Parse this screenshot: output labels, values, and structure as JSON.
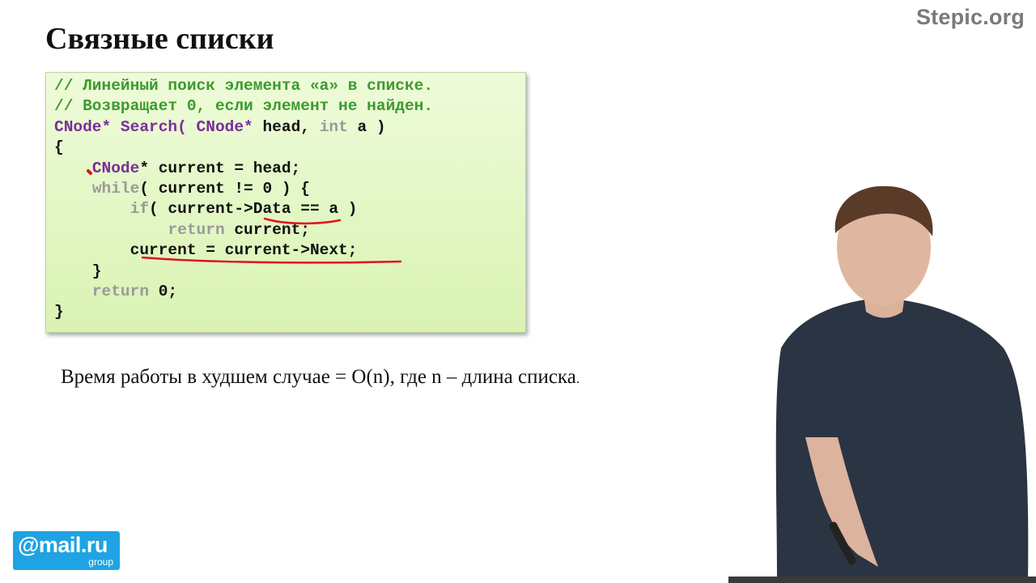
{
  "brand": {
    "site": "Stepic.org"
  },
  "slide": {
    "title": "Связные списки",
    "code": [
      [
        {
          "t": "// Линейный поиск элемента «a» в списке.",
          "c": "com"
        }
      ],
      [
        {
          "t": "// Возвращает 0, если элемент не найден.",
          "c": "com"
        }
      ],
      [
        {
          "t": "CNode*",
          "c": "type"
        },
        {
          "t": " ",
          "c": "txt"
        },
        {
          "t": "Search(",
          "c": "type"
        },
        {
          "t": " ",
          "c": "txt"
        },
        {
          "t": "CNode*",
          "c": "type"
        },
        {
          "t": " head, ",
          "c": "txt"
        },
        {
          "t": "int",
          "c": "kw"
        },
        {
          "t": " a )",
          "c": "txt"
        }
      ],
      [
        {
          "t": "{",
          "c": "txt"
        }
      ],
      [
        {
          "t": "    ",
          "c": "txt"
        },
        {
          "t": "CNode",
          "c": "type"
        },
        {
          "t": "* current = head;",
          "c": "txt"
        }
      ],
      [
        {
          "t": "    ",
          "c": "txt"
        },
        {
          "t": "while",
          "c": "kw"
        },
        {
          "t": "( current != 0 ) {",
          "c": "txt"
        }
      ],
      [
        {
          "t": "        ",
          "c": "txt"
        },
        {
          "t": "if",
          "c": "kw"
        },
        {
          "t": "( current->Data == a )",
          "c": "txt"
        }
      ],
      [
        {
          "t": "            ",
          "c": "txt"
        },
        {
          "t": "return",
          "c": "kw"
        },
        {
          "t": " current;",
          "c": "txt"
        }
      ],
      [
        {
          "t": "        current = current->Next;",
          "c": "txt"
        }
      ],
      [
        {
          "t": "    }",
          "c": "txt"
        }
      ],
      [
        {
          "t": "    ",
          "c": "txt"
        },
        {
          "t": "return",
          "c": "kw"
        },
        {
          "t": " 0;",
          "c": "txt"
        }
      ],
      [
        {
          "t": "}",
          "c": "txt"
        }
      ]
    ],
    "statement_main": "Время работы в худшем случае = O(n), где n – длина списка",
    "statement_end": "."
  },
  "logo": {
    "main": "@mail.ru",
    "sub": "group"
  },
  "colors": {
    "comment": "#3c9a2e",
    "type": "#7a2d9c",
    "keyword": "#9a9a9a",
    "annotation": "#e0101e",
    "brand_gray": "#7a7a7a",
    "logo_blue": "#1fa3e3"
  }
}
